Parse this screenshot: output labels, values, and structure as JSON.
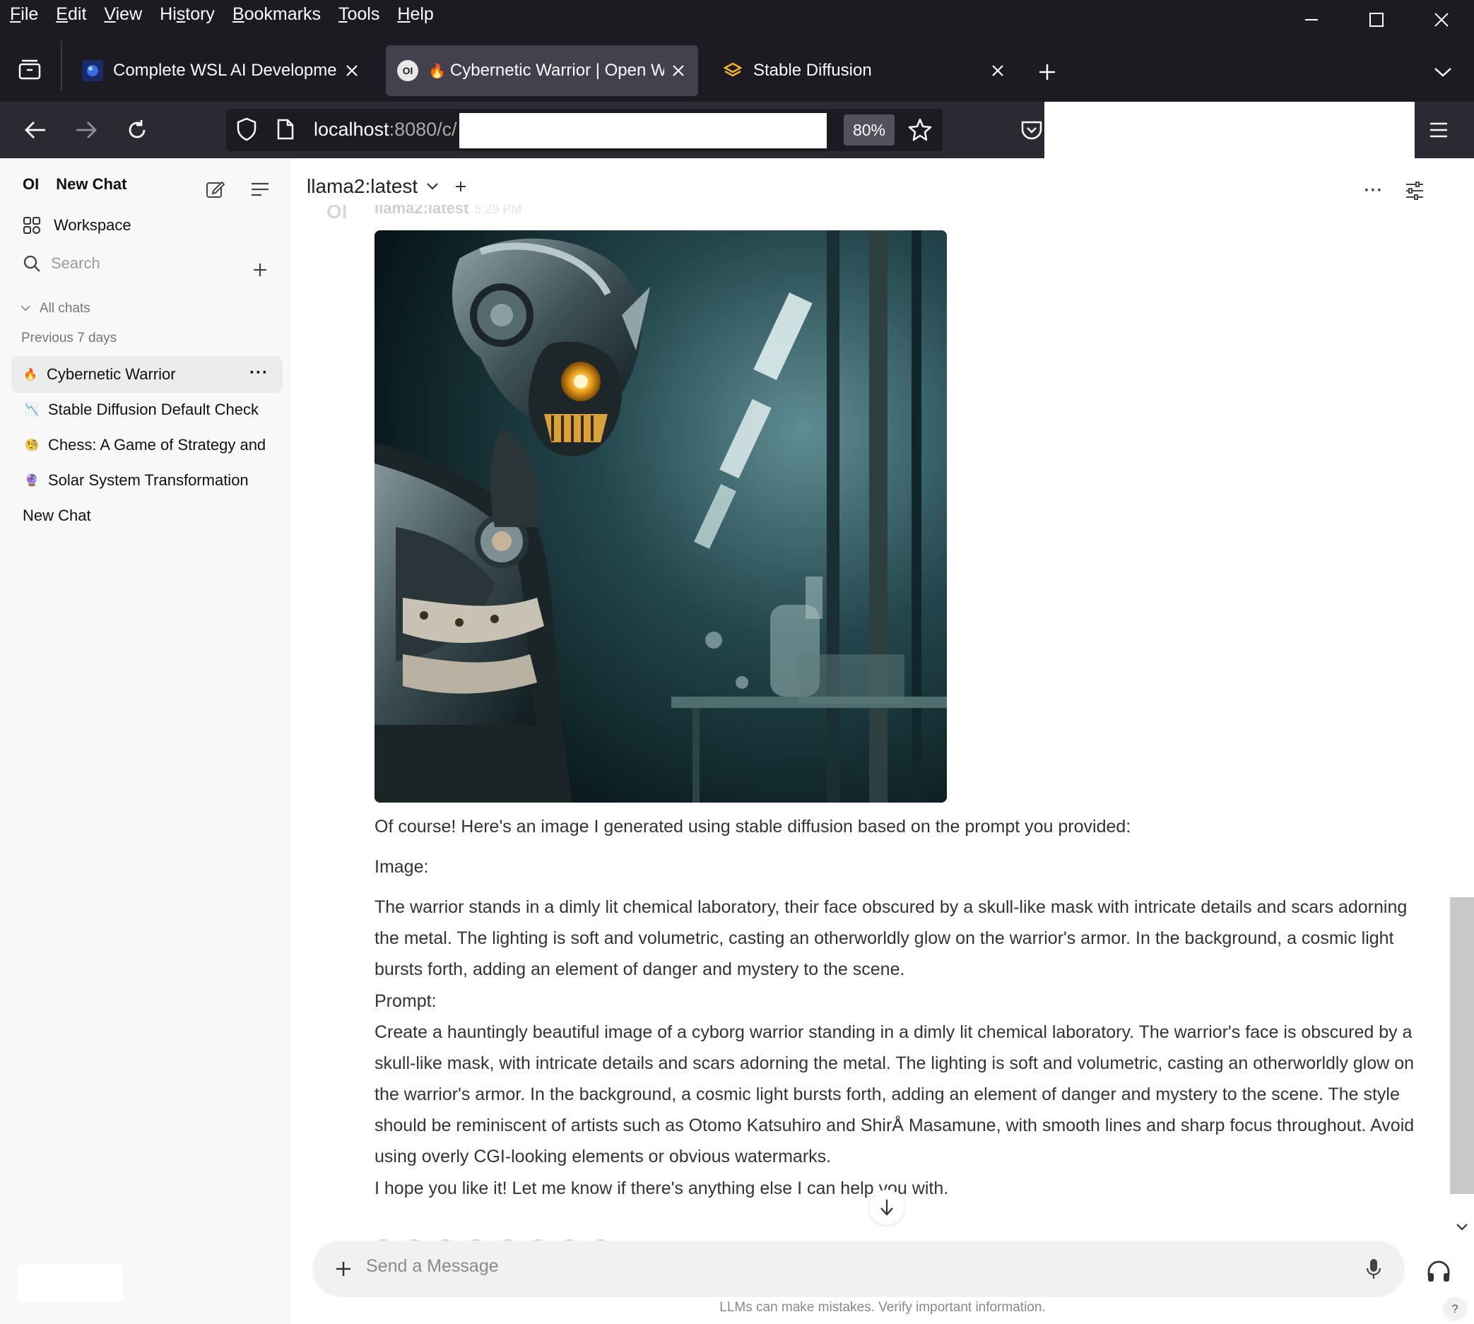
{
  "menubar": {
    "items": [
      {
        "prefix": "",
        "ul": "F",
        "rest": "ile"
      },
      {
        "prefix": "",
        "ul": "E",
        "rest": "dit"
      },
      {
        "prefix": "",
        "ul": "V",
        "rest": "iew"
      },
      {
        "prefix": "Hi",
        "ul": "s",
        "rest": "tory"
      },
      {
        "prefix": "",
        "ul": "B",
        "rest": "ookmarks"
      },
      {
        "prefix": "",
        "ul": "T",
        "rest": "ools"
      },
      {
        "prefix": "",
        "ul": "H",
        "rest": "elp"
      }
    ]
  },
  "tabs": [
    {
      "title": "Complete WSL AI Development",
      "active": false
    },
    {
      "title": "Cybernetic Warrior | Open WebUI",
      "active": true
    },
    {
      "title": "Stable Diffusion",
      "active": false
    }
  ],
  "navbar": {
    "url_host": "localhost",
    "url_rest": ":8080/c/",
    "zoom": "80%"
  },
  "sidebar": {
    "logo": "OI",
    "new_chat": "New Chat",
    "workspace": "Workspace",
    "search_placeholder": "Search",
    "all_chats": "All chats",
    "section_label": "Previous 7 days",
    "chats": [
      {
        "title": "Cybernetic Warrior",
        "emoji": "🔥",
        "active": true
      },
      {
        "title": "Stable Diffusion Default Check",
        "emoji": "📉",
        "active": false
      },
      {
        "title": "Chess: A Game of Strategy and",
        "emoji": "🧐",
        "active": false
      },
      {
        "title": "Solar System Transformation",
        "emoji": "🔮",
        "active": false
      },
      {
        "title": "New Chat",
        "emoji": "",
        "active": false
      }
    ]
  },
  "chat": {
    "model": "llama2:latest",
    "ghost_model": "llama2:latest",
    "ghost_time": "5:29 PM",
    "paragraphs": [
      "Of course! Here's an image I generated using stable diffusion based on the prompt you provided:",
      "Image:",
      "The warrior stands in a dimly lit chemical laboratory, their face obscured by a skull-like mask with intricate details and scars adorning the metal. The lighting is soft and volumetric, casting an otherworldly glow on the warrior's armor. In the background, a cosmic light bursts forth, adding an element of danger and mystery to the scene.",
      "Prompt:",
      "Create a hauntingly beautiful image of a cyborg warrior standing in a dimly lit chemical laboratory. The warrior's face is obscured by a skull-like mask, with intricate details and scars adorning the metal. The lighting is soft and volumetric, casting an otherworldly glow on the warrior's armor. In the background, a cosmic light bursts forth, adding an element of danger and mystery to the scene. The style should be reminiscent of artists such as Otomo Katsuhiro and ShirÅ Masamune, with smooth lines and sharp focus throughout. Avoid using overly CGI-looking elements or obvious watermarks.",
      "I hope you like it! Let me know if there's anything else I can help you with."
    ]
  },
  "composer": {
    "placeholder": "Send a Message"
  },
  "footer": {
    "disclaimer": "LLMs can make mistakes. Verify important information.",
    "help": "?"
  }
}
